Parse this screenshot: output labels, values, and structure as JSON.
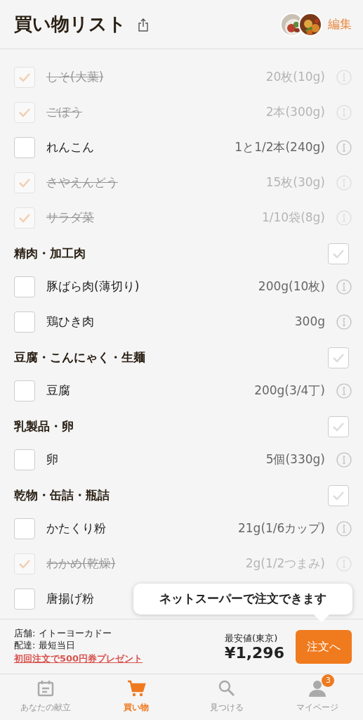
{
  "header": {
    "title": "買い物リスト",
    "edit": "編集"
  },
  "list": [
    {
      "kind": "item",
      "name": "しそ(大葉)",
      "amount": "20枚(10g)",
      "checked": true
    },
    {
      "kind": "item",
      "name": "ごぼう",
      "amount": "2本(300g)",
      "checked": true
    },
    {
      "kind": "item",
      "name": "れんこん",
      "amount": "1と1/2本(240g)",
      "checked": false
    },
    {
      "kind": "item",
      "name": "さやえんどう",
      "amount": "15枚(30g)",
      "checked": true
    },
    {
      "kind": "item",
      "name": "サラダ菜",
      "amount": "1/10袋(8g)",
      "checked": true
    },
    {
      "kind": "section",
      "name": "精肉・加工肉",
      "checked": false
    },
    {
      "kind": "item",
      "name": "豚ばら肉(薄切り)",
      "amount": "200g(10枚)",
      "checked": false
    },
    {
      "kind": "item",
      "name": "鶏ひき肉",
      "amount": "300g",
      "checked": false
    },
    {
      "kind": "section",
      "name": "豆腐・こんにゃく・生麺",
      "checked": false
    },
    {
      "kind": "item",
      "name": "豆腐",
      "amount": "200g(3/4丁)",
      "checked": false
    },
    {
      "kind": "section",
      "name": "乳製品・卵",
      "checked": false
    },
    {
      "kind": "item",
      "name": "卵",
      "amount": "5個(330g)",
      "checked": false
    },
    {
      "kind": "section",
      "name": "乾物・缶詰・瓶詰",
      "checked": false
    },
    {
      "kind": "item",
      "name": "かたくり粉",
      "amount": "21g(1/6カップ)",
      "checked": false
    },
    {
      "kind": "item",
      "name": "わかめ(乾燥)",
      "amount": "2g(1/2つまみ)",
      "checked": true
    },
    {
      "kind": "item",
      "name": "唐揚げ粉",
      "checked": false
    }
  ],
  "tooltip": "ネットスーパーで注文できます",
  "order": {
    "store": "店舗: イトーヨーカドー",
    "delivery": "配達: 最短当日",
    "promo": "初回注文で500円券プレゼント",
    "price_label": "最安値(東京)",
    "price": "¥1,296",
    "button": "注文へ"
  },
  "tabs": [
    {
      "label": "あなたの献立",
      "selected": false
    },
    {
      "label": "買い物",
      "selected": true
    },
    {
      "label": "見つける",
      "selected": false
    },
    {
      "label": "マイページ",
      "selected": false,
      "badge": "3"
    }
  ]
}
